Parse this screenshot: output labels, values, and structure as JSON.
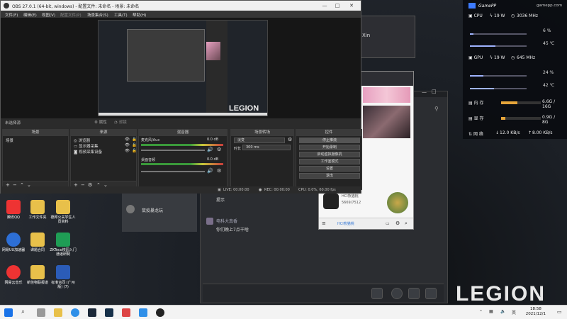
{
  "obs": {
    "title": "OBS 27.0.1 (64-bit, windows) - 配置文件: 未命名 - 场景: 未命名",
    "menu": [
      "文件(F)",
      "编辑(E)",
      "视图(V)",
      "配置文件(P)",
      "场景集合(S)",
      "工具(T)",
      "帮助(H)"
    ],
    "no_source": "未选择源",
    "properties_btn": "属性",
    "filters_btn": "滤镜",
    "docks": {
      "scenes": {
        "title": "场景",
        "items": [
          "场景"
        ]
      },
      "sources": {
        "title": "来源",
        "items": [
          "浏览器",
          "显示器采集",
          "视频采集设备"
        ]
      },
      "mixer": {
        "title": "混音器",
        "tracks": [
          {
            "name": "麦克风/Aux",
            "db": "0.0 dB",
            "level": 0.72
          },
          {
            "name": "桌面音频",
            "db": "0.0 dB",
            "level": 0.6
          }
        ]
      },
      "transitions": {
        "title": "场景转场",
        "mode": "淡变",
        "duration_label": "时长",
        "duration": "300 ms"
      },
      "controls": {
        "title": "控件",
        "buttons": [
          "停止推流",
          "开始录制",
          "启动虚拟摄像机",
          "工作室模式",
          "设置",
          "退出"
        ]
      }
    },
    "status": {
      "live": "LIVE: 00:00:00",
      "rec": "REC: 00:00:00",
      "cpu": "CPU: 0.0%, 60.00 fps"
    }
  },
  "gamepp": {
    "brand": "GamePP",
    "site": "gamepp.com",
    "cpu": {
      "label": "CPU",
      "power": "19 W",
      "freq": "3036 MHz",
      "usage": "6 %",
      "temp": "45 ℃",
      "usage_level": 0.06
    },
    "gpu": {
      "label": "GPU",
      "power": "19 W",
      "freq": "645 MHz",
      "usage": "24 %",
      "temp": "42 ℃",
      "usage_level": 0.24
    },
    "mem": {
      "label": "内 存",
      "value": "6.6G / 16G",
      "level": 0.41
    },
    "vmem": {
      "label": "显 存",
      "value": "0.9G / 8G",
      "level": 0.11
    },
    "net": {
      "label": "网 络",
      "down": "12.0 KB/s",
      "up": "8.00 KB/s"
    }
  },
  "chat": {
    "user": "Xin",
    "left_item": "鼠疫暴龙玩",
    "tip": "提示",
    "sender": "电科大真香",
    "message": "你们晚上7点干啥"
  },
  "phone": {
    "hashtag": "HCI熊猫桃",
    "count": "5669/7512",
    "footer": "HCI熊猫桃"
  },
  "desktop_icons": [
    {
      "label": "腾讯QQ",
      "color": "#e33"
    },
    {
      "label": "工作文件夹",
      "color": "#e8c04a"
    },
    {
      "label": "德邦公关学生人员资料",
      "color": "#e8c04a"
    },
    {
      "label": "网易UU加速器",
      "color": "#2d6fd6"
    },
    {
      "label": "课题合同",
      "color": "#e8c04a"
    },
    {
      "label": "ZKTeco校园入门通道研制",
      "color": "#1f9d55"
    },
    {
      "label": "网易云音乐",
      "color": "#e33"
    },
    {
      "label": "新佳物联报道",
      "color": "#e8c04a"
    },
    {
      "label": "标准合同 (广州版) (7)",
      "color": "#2b5cb8"
    }
  ],
  "wallpaper_brand": "LEGION",
  "taskbar": {
    "time": "18:58",
    "date": "2021/12/1"
  }
}
